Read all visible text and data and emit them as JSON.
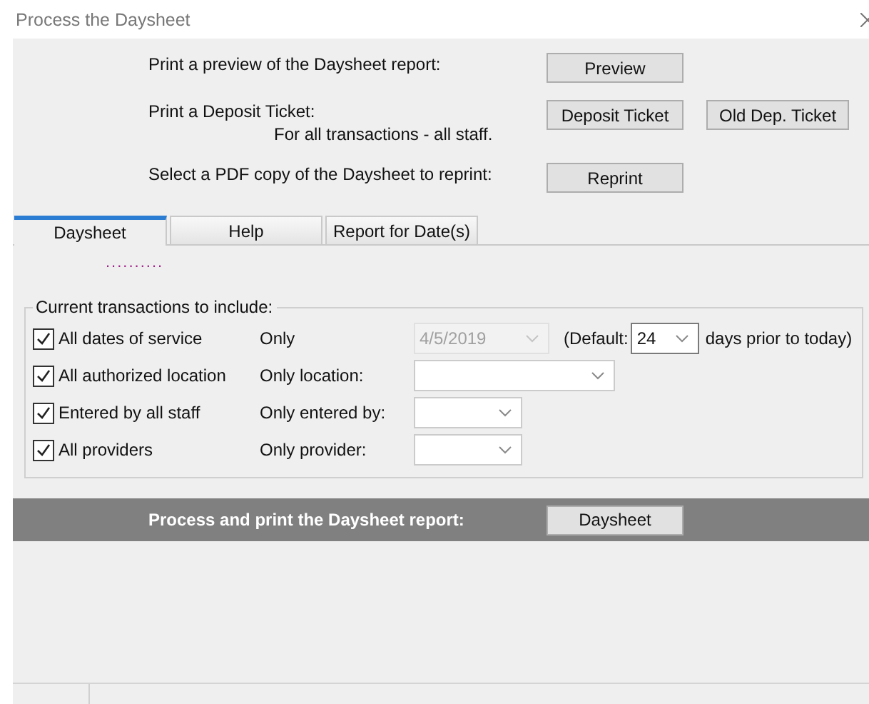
{
  "window": {
    "title": "Process the Daysheet"
  },
  "actions": [
    {
      "label": "Print a preview of the Daysheet report:",
      "buttons": [
        "Preview"
      ]
    },
    {
      "label": "Print a Deposit Ticket:",
      "sublabel": "For all transactions - all staff.",
      "buttons": [
        "Deposit Ticket",
        "Old Dep. Ticket"
      ]
    },
    {
      "label": "Select a PDF copy of the Daysheet to reprint:",
      "buttons": [
        "Reprint"
      ]
    }
  ],
  "tabs": [
    {
      "label": "Daysheet",
      "selected": true
    },
    {
      "label": "Help",
      "selected": false
    },
    {
      "label": "Report for Date(s)",
      "selected": false
    }
  ],
  "focus_dots": "..........",
  "group": {
    "title": "Current transactions to include:",
    "rows": [
      {
        "checkbox": "All dates of service",
        "checked": true,
        "filter_label": "Only",
        "combo": {
          "value": "4/5/2019",
          "disabled": true
        },
        "default_label": "(Default:",
        "default_combo": "24",
        "suffix": "days prior to today)"
      },
      {
        "checkbox": "All authorized location",
        "checked": true,
        "filter_label": "Only location:",
        "combo": {
          "disabled": false
        }
      },
      {
        "checkbox": "Entered by all staff",
        "checked": true,
        "filter_label": "Only entered by:",
        "combo": {
          "disabled": false
        }
      },
      {
        "checkbox": "All providers",
        "checked": true,
        "filter_label": "Only provider:",
        "combo": {
          "disabled": false
        }
      }
    ]
  },
  "process_bar": {
    "label": "Process and print the Daysheet report:",
    "button": "Daysheet"
  }
}
